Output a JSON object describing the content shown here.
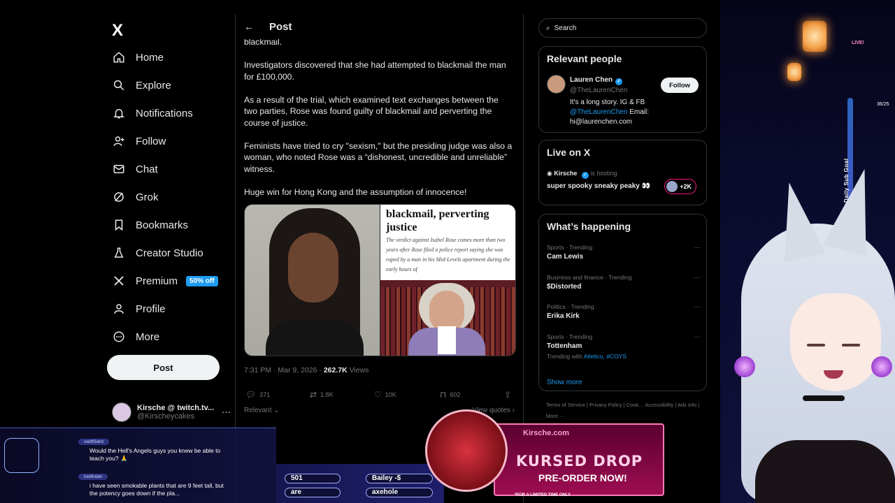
{
  "nav": {
    "logo": "X",
    "items": [
      {
        "label": "Home",
        "icon": "home-icon"
      },
      {
        "label": "Explore",
        "icon": "search-icon"
      },
      {
        "label": "Notifications",
        "icon": "bell-icon"
      },
      {
        "label": "Follow",
        "icon": "person-plus-icon"
      },
      {
        "label": "Chat",
        "icon": "mail-icon"
      },
      {
        "label": "Grok",
        "icon": "grok-icon"
      },
      {
        "label": "Bookmarks",
        "icon": "bookmark-icon"
      },
      {
        "label": "Creator Studio",
        "icon": "flask-icon"
      },
      {
        "label": "Premium",
        "icon": "x-icon",
        "badge": "50% off"
      },
      {
        "label": "Profile",
        "icon": "person-icon"
      },
      {
        "label": "More",
        "icon": "more-circle-icon"
      }
    ],
    "post_button": "Post",
    "account": {
      "name": "Kirsche @ twitch.tv...",
      "handle": "@Kirscheycakes",
      "more": "···"
    }
  },
  "post": {
    "header_title": "Post",
    "back_glyph": "←",
    "paragraphs": [
      "blackmail.",
      "Investigators discovered that she had attempted to blackmail the man for £100,000.",
      "As a result of the trial, which examined text exchanges between the two parties, Rose was found guilty of blackmail and perverting the course of justice.",
      "Feminists have tried to cry \"sexism,\" but the presiding judge was also a woman, who noted Rose was a “dishonest, uncredible and unreliable” witness.",
      "Huge win for Hong Kong and the assumption of innocence!"
    ],
    "media": {
      "headline": "blackmail, perverting justice",
      "subtext": "The verdict against Isabel Rose comes more than two years after Rose filed a police report saying she was raped by a man in his Mid-Levels apartment during the early hours of"
    },
    "meta": {
      "time": "7:31 PM · Mar 9, 2026 · ",
      "views_count": "262.7K",
      "views_label": " Views"
    },
    "actions": {
      "replies": "371",
      "reposts": "1.8K",
      "likes": "10K",
      "bookmarks": "602"
    },
    "relevant": "Relevant",
    "view_quotes": "View quotes"
  },
  "right": {
    "search_placeholder": "Search",
    "relevant_people": {
      "title": "Relevant people",
      "name": "Lauren Chen",
      "handle": "@TheLaurenChen",
      "bio_1": "It's a long story. IG & FB",
      "bio_link": "@TheLaurenChen",
      "bio_2": " Email:",
      "bio_3": "hi@laurenchen.com",
      "follow": "Follow"
    },
    "live": {
      "title": "Live on X",
      "host_name": "Kirsche",
      "host_suffix": "is hosting",
      "stream_title": "super spooky sneaky peaky 👀",
      "count": "+2K"
    },
    "happening": {
      "title": "What’s happening",
      "trends": [
        {
          "cat": "Sports · Trending",
          "name": "Cam Lewis"
        },
        {
          "cat": "Business and finance · Trending",
          "name": "$Distorted"
        },
        {
          "cat": "Politics · Trending",
          "name": "Erika Kirk"
        },
        {
          "cat": "Sports · Trending",
          "name": "Tottenham",
          "with_prefix": "Trending with ",
          "with_links": "Atletico, #COYS"
        }
      ],
      "show_more": "Show more"
    },
    "footer": "Terms of Service  |  Privacy Policy  |  Cook…  Accessibility  |  Ads info  |  More ···"
  },
  "overlay": {
    "live_tag": "LIVE!",
    "sub_goal": "Daily Sub Goal",
    "sub_count": "36/25",
    "chat": [
      {
        "user": "swiftSwrd",
        "text": "Would the Hell's Angels guys you knew be able to teach you? 🙏"
      },
      {
        "user": "lostfinder",
        "text": "i have seen smokable plants that are 9 feet tall, but the potency goes down if the pla..."
      }
    ],
    "pills": [
      "501",
      "Bailey -$",
      "are",
      "axehole"
    ],
    "merch": {
      "site": "Kirsche.com",
      "title": "KURSED DROP",
      "subtitle": "PRE-ORDER NOW!",
      "fine": "*FOR A LIMITED TIME ONLY"
    }
  }
}
